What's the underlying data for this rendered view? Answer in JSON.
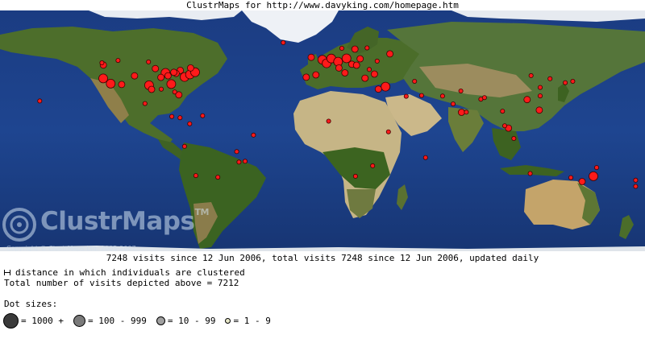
{
  "title": "ClustrMaps for http://www.davyking.com/homepage.htm",
  "watermark": {
    "brand_clustr": "Clustr",
    "brand_maps": "Maps",
    "tm": "TM",
    "copyright": "Copyright © ClustrMaps Ltd. 2005-2007"
  },
  "caption": "7248 visits since 12 Jun 2006, total visits 7248 since 12 Jun 2006, updated daily",
  "distance_note": "distance in which individuals are clustered",
  "total_visits_line": "Total number of visits depicted above = 7212",
  "dot_sizes_heading": "Dot sizes:",
  "legend": [
    {
      "label": "= 1000 +"
    },
    {
      "label": "= 100 - 999"
    },
    {
      "label": "= 10 - 99"
    },
    {
      "label": "= 1 - 9"
    }
  ],
  "colors": {
    "ocean": "#1c3f86",
    "land": "#4e6f2c",
    "desert": "#c9b98c",
    "ice": "#f2f4f8",
    "dot": "#ff1a1a"
  },
  "dots": [
    {
      "lon": -122.4,
      "lat": 37.8,
      "size": "large"
    },
    {
      "lon": -118.2,
      "lat": 34.0,
      "size": "large"
    },
    {
      "lon": -122.3,
      "lat": 47.6,
      "size": "medium"
    },
    {
      "lon": -104.9,
      "lat": 39.7,
      "size": "medium"
    },
    {
      "lon": -96.8,
      "lat": 32.8,
      "size": "large"
    },
    {
      "lon": -95.4,
      "lat": 29.8,
      "size": "medium"
    },
    {
      "lon": -87.6,
      "lat": 41.9,
      "size": "large"
    },
    {
      "lon": -84.4,
      "lat": 33.7,
      "size": "large"
    },
    {
      "lon": -80.2,
      "lat": 25.8,
      "size": "medium"
    },
    {
      "lon": -77.0,
      "lat": 38.9,
      "size": "large"
    },
    {
      "lon": -74.0,
      "lat": 40.7,
      "size": "large"
    },
    {
      "lon": -71.1,
      "lat": 42.4,
      "size": "large"
    },
    {
      "lon": -79.4,
      "lat": 43.7,
      "size": "medium"
    },
    {
      "lon": -73.6,
      "lat": 45.5,
      "size": "medium"
    },
    {
      "lon": -90.2,
      "lat": 38.6,
      "size": "medium"
    },
    {
      "lon": -93.3,
      "lat": 45.0,
      "size": "medium"
    },
    {
      "lon": -112.1,
      "lat": 33.4,
      "size": "medium"
    },
    {
      "lon": -123.1,
      "lat": 49.3,
      "size": "small"
    },
    {
      "lon": -114.1,
      "lat": 51.0,
      "size": "small"
    },
    {
      "lon": -97.1,
      "lat": 49.9,
      "size": "small"
    },
    {
      "lon": -86.2,
      "lat": 39.8,
      "size": "medium"
    },
    {
      "lon": -81.7,
      "lat": 41.5,
      "size": "medium"
    },
    {
      "lon": -83.0,
      "lat": 42.3,
      "size": "medium"
    },
    {
      "lon": -99.1,
      "lat": 19.4,
      "size": "small"
    },
    {
      "lon": -157.8,
      "lat": 21.3,
      "size": "small"
    },
    {
      "lon": -90.0,
      "lat": 30.0,
      "size": "small"
    },
    {
      "lon": -82.5,
      "lat": 27.9,
      "size": "small"
    },
    {
      "lon": -84.1,
      "lat": 9.9,
      "size": "small"
    },
    {
      "lon": -79.5,
      "lat": 9.0,
      "size": "small"
    },
    {
      "lon": -74.1,
      "lat": 4.6,
      "size": "small"
    },
    {
      "lon": -66.9,
      "lat": 10.5,
      "size": "small"
    },
    {
      "lon": -77.0,
      "lat": -12.0,
      "size": "small"
    },
    {
      "lon": -70.7,
      "lat": -33.4,
      "size": "small"
    },
    {
      "lon": -58.4,
      "lat": -34.6,
      "size": "small"
    },
    {
      "lon": -46.6,
      "lat": -23.5,
      "size": "small"
    },
    {
      "lon": -43.2,
      "lat": -22.9,
      "size": "small"
    },
    {
      "lon": -47.9,
      "lat": -15.8,
      "size": "small"
    },
    {
      "lon": -38.5,
      "lat": -3.7,
      "size": "small"
    },
    {
      "lon": -0.1,
      "lat": 51.5,
      "size": "large"
    },
    {
      "lon": 2.3,
      "lat": 48.9,
      "size": "large"
    },
    {
      "lon": -3.7,
      "lat": 40.4,
      "size": "medium"
    },
    {
      "lon": -9.1,
      "lat": 38.7,
      "size": "medium"
    },
    {
      "lon": 4.9,
      "lat": 52.4,
      "size": "large"
    },
    {
      "lon": 13.4,
      "lat": 52.5,
      "size": "large"
    },
    {
      "lon": 8.7,
      "lat": 50.1,
      "size": "large"
    },
    {
      "lon": 12.5,
      "lat": 41.9,
      "size": "medium"
    },
    {
      "lon": 9.2,
      "lat": 45.5,
      "size": "medium"
    },
    {
      "lon": 16.4,
      "lat": 48.2,
      "size": "medium"
    },
    {
      "lon": 21.0,
      "lat": 52.2,
      "size": "medium"
    },
    {
      "lon": 18.1,
      "lat": 59.3,
      "size": "medium"
    },
    {
      "lon": 10.8,
      "lat": 59.9,
      "size": "small"
    },
    {
      "lon": 24.9,
      "lat": 60.2,
      "size": "small"
    },
    {
      "lon": 37.6,
      "lat": 55.8,
      "size": "medium"
    },
    {
      "lon": 30.5,
      "lat": 50.5,
      "size": "small"
    },
    {
      "lon": 23.7,
      "lat": 38.0,
      "size": "medium"
    },
    {
      "lon": 29.0,
      "lat": 41.0,
      "size": "medium"
    },
    {
      "lon": 26.1,
      "lat": 44.4,
      "size": "small"
    },
    {
      "lon": 19.0,
      "lat": 47.5,
      "size": "medium"
    },
    {
      "lon": -6.3,
      "lat": 53.3,
      "size": "medium"
    },
    {
      "lon": -21.9,
      "lat": 64.1,
      "size": "small"
    },
    {
      "lon": 35.2,
      "lat": 31.8,
      "size": "large"
    },
    {
      "lon": 31.2,
      "lat": 30.0,
      "size": "medium"
    },
    {
      "lon": 46.7,
      "lat": 24.7,
      "size": "small"
    },
    {
      "lon": 55.3,
      "lat": 25.3,
      "size": "small"
    },
    {
      "lon": 51.4,
      "lat": 35.7,
      "size": "small"
    },
    {
      "lon": 67.0,
      "lat": 24.9,
      "size": "small"
    },
    {
      "lon": 77.2,
      "lat": 28.6,
      "size": "small"
    },
    {
      "lon": 72.9,
      "lat": 19.1,
      "size": "small"
    },
    {
      "lon": 77.6,
      "lat": 13.0,
      "size": "medium"
    },
    {
      "lon": 80.3,
      "lat": 13.1,
      "size": "small"
    },
    {
      "lon": 88.4,
      "lat": 22.6,
      "size": "small"
    },
    {
      "lon": 90.4,
      "lat": 23.8,
      "size": "small"
    },
    {
      "lon": 100.5,
      "lat": 13.8,
      "size": "small"
    },
    {
      "lon": 103.8,
      "lat": 1.4,
      "size": "medium"
    },
    {
      "lon": 101.7,
      "lat": 3.1,
      "size": "small"
    },
    {
      "lon": 106.8,
      "lat": -6.2,
      "size": "small"
    },
    {
      "lon": 121.0,
      "lat": 14.6,
      "size": "medium"
    },
    {
      "lon": 114.2,
      "lat": 22.3,
      "size": "medium"
    },
    {
      "lon": 121.5,
      "lat": 25.0,
      "size": "small"
    },
    {
      "lon": 121.5,
      "lat": 31.2,
      "size": "small"
    },
    {
      "lon": 116.4,
      "lat": 39.9,
      "size": "small"
    },
    {
      "lon": 127.0,
      "lat": 37.6,
      "size": "small"
    },
    {
      "lon": 139.7,
      "lat": 35.7,
      "size": "small"
    },
    {
      "lon": 135.5,
      "lat": 34.7,
      "size": "small"
    },
    {
      "lon": 151.2,
      "lat": -33.9,
      "size": "large"
    },
    {
      "lon": 144.9,
      "lat": -37.8,
      "size": "medium"
    },
    {
      "lon": 153.0,
      "lat": -27.5,
      "size": "small"
    },
    {
      "lon": 115.9,
      "lat": -31.9,
      "size": "small"
    },
    {
      "lon": 138.6,
      "lat": -34.9,
      "size": "small"
    },
    {
      "lon": 174.8,
      "lat": -36.8,
      "size": "small"
    },
    {
      "lon": 174.8,
      "lat": -41.3,
      "size": "small"
    },
    {
      "lon": 28.0,
      "lat": -26.2,
      "size": "small"
    },
    {
      "lon": 18.4,
      "lat": -33.9,
      "size": "small"
    },
    {
      "lon": 36.8,
      "lat": -1.3,
      "size": "small"
    },
    {
      "lon": 3.4,
      "lat": 6.5,
      "size": "small"
    },
    {
      "lon": 57.5,
      "lat": -20.2,
      "size": "small"
    }
  ]
}
